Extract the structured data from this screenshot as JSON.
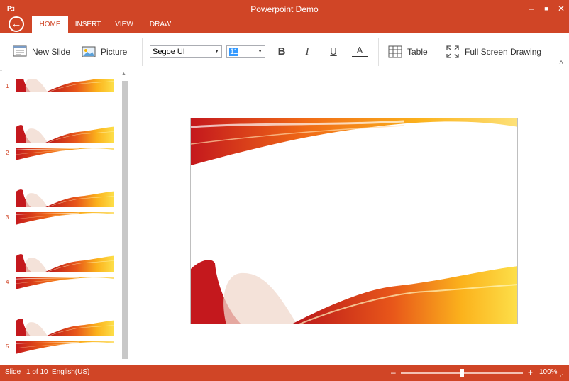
{
  "app": {
    "title": "Powerpoint Demo",
    "icon_text": "P◘"
  },
  "window_controls": {
    "minimize": "–",
    "maximize": "■",
    "close": "✕"
  },
  "tabs": [
    {
      "label": "HOME"
    },
    {
      "label": "INSERT"
    },
    {
      "label": "VIEW"
    },
    {
      "label": "DRAW"
    }
  ],
  "ribbon": {
    "new_slide": "New Slide",
    "picture": "Picture",
    "font_family": "Segoe UI",
    "font_size": "11",
    "bold": "B",
    "italic": "I",
    "underline": "U",
    "font_color": "A",
    "table": "Table",
    "full_screen": "Full Screen Drawing",
    "collapse": "˄"
  },
  "slides": [
    {
      "number": "1"
    },
    {
      "number": "2"
    },
    {
      "number": "3"
    },
    {
      "number": "4"
    },
    {
      "number": "5"
    }
  ],
  "status": {
    "slide_label": "Slide",
    "slide_position": "1 of 10",
    "language": "English(US)",
    "zoom_minus": "–",
    "zoom_plus": "+",
    "zoom_level": "100%",
    "zoom_fraction": 0.5
  },
  "colors": {
    "accent": "#d04526",
    "wave_red": "#c4181d",
    "wave_orange": "#f28b16",
    "wave_yellow": "#fbd52a"
  }
}
